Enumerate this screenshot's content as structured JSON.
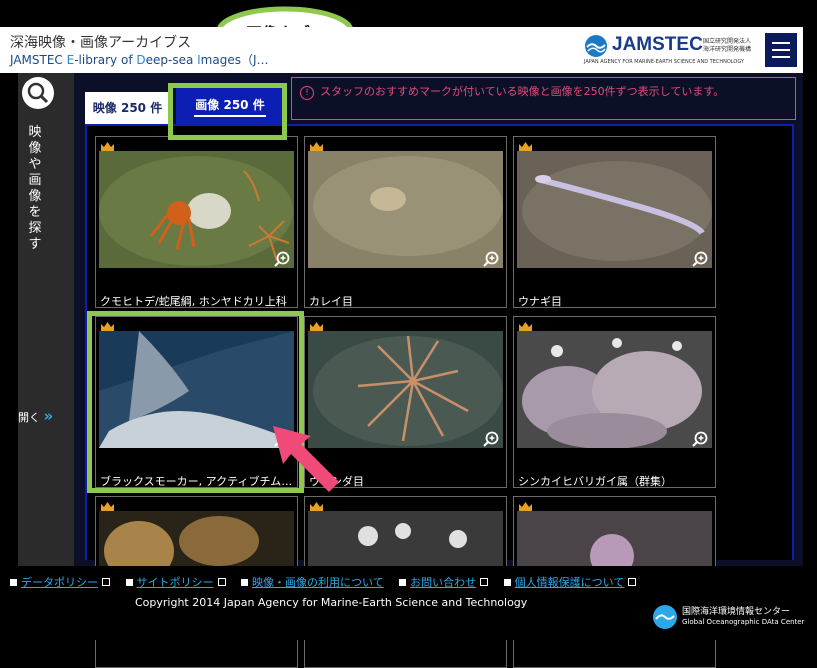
{
  "callout": {
    "label": "画像タブ"
  },
  "header": {
    "title": "深海映像・画像アーカイブス",
    "subtitle_parts": [
      "JAMSTEC ",
      "E",
      "-library of ",
      "D",
      "eep-sea ",
      "I",
      "mages（J",
      "…"
    ],
    "logo": {
      "name": "JAMSTEC",
      "jp_line1": "国立研究開発法人",
      "jp_line2": "海洋研究開発機構",
      "en": "JAPAN AGENCY FOR MARINE-EARTH SCIENCE AND TECHNOLOGY"
    }
  },
  "sidebar": {
    "label": "映像や画像を探す",
    "open_label": "開く"
  },
  "tabs": {
    "video": "映像 250 件",
    "image": "画像 250 件"
  },
  "notice": {
    "text": "スタッフのおすすめマークが付いている映像と画像を250件ずつ表示しています。"
  },
  "cards": [
    {
      "caption": "クモヒトデ/蛇尾綱, ホンヤドカリ上科"
    },
    {
      "caption": "カレイ目"
    },
    {
      "caption": "ウナギ目"
    },
    {
      "caption": "ブラックスモーカー, アクティブチム…"
    },
    {
      "caption": "ウミシダ目"
    },
    {
      "caption": "シンカイヒバリガイ属（群集）"
    },
    {
      "caption": ""
    },
    {
      "caption": ""
    },
    {
      "caption": ""
    }
  ],
  "footer": {
    "links": [
      "データポリシー",
      "サイトポリシー",
      "映像・画像の利用について",
      "お問い合わせ",
      "個人情報保護について"
    ],
    "copyright": "Copyright 2014 Japan Agency for Marine-Earth Science and Technology",
    "goda_jp": "国際海洋環境情報センター",
    "goda_en": "Global Oceanographic DAta Center"
  },
  "colors": {
    "accent_green": "#8ec84e",
    "tab_blue": "#0c1fb2",
    "notice_pink": "#e04c76",
    "link_blue": "#2aa8e8"
  }
}
